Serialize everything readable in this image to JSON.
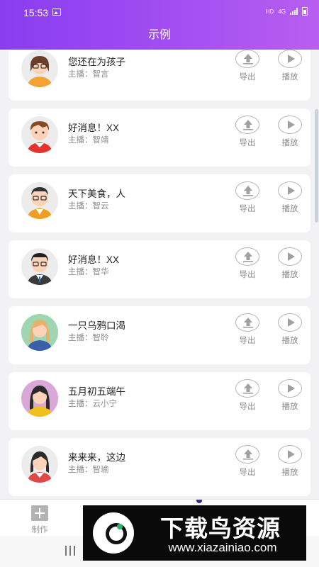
{
  "status_bar": {
    "time": "15:53",
    "network": "HD",
    "signal": "4G"
  },
  "header": {
    "title": "示例"
  },
  "items": [
    {
      "title": "您还在为孩子",
      "host": "主播：智言",
      "avatar": "woman-glasses-avatar",
      "export_label": "导出",
      "play_label": "播放"
    },
    {
      "title": "好消息！XX",
      "host": "主播：智靖",
      "avatar": "boy-avatar",
      "export_label": "导出",
      "play_label": "播放"
    },
    {
      "title": "天下美食，人",
      "host": "主播：智云",
      "avatar": "man-glasses-orange-avatar",
      "export_label": "导出",
      "play_label": "播放"
    },
    {
      "title": "好消息！XX",
      "host": "主播：智华",
      "avatar": "man-suit-avatar",
      "export_label": "导出",
      "play_label": "播放"
    },
    {
      "title": "一只乌鸦口渴",
      "host": "主播：智聆",
      "avatar": "blonde-woman-avatar",
      "export_label": "导出",
      "play_label": "播放"
    },
    {
      "title": "五月初五端午",
      "host": "主播：云小宁",
      "avatar": "girl-avatar",
      "export_label": "导出",
      "play_label": "播放"
    },
    {
      "title": "来来来，这边",
      "host": "主播：智瑜",
      "avatar": "woman-red-avatar",
      "export_label": "导出",
      "play_label": "播放"
    }
  ],
  "bottom_nav": {
    "make_label": "制作"
  },
  "watermark": {
    "title": "下载鸟资源",
    "url": "www.xiazainiao.com"
  },
  "colors": {
    "header_start": "#8a3cf0",
    "header_end": "#b85ff0",
    "background": "#f2f2f4"
  }
}
